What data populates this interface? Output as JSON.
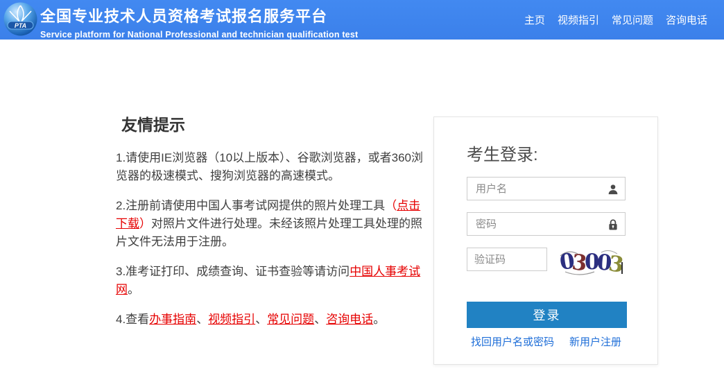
{
  "header": {
    "logo_text": "PTA",
    "title": "全国专业技术人员资格考试报名服务平台",
    "subtitle": "Service platform for National Professional and technician qualification test",
    "nav": [
      {
        "label": "主页"
      },
      {
        "label": "视频指引"
      },
      {
        "label": "常见问题"
      },
      {
        "label": "咨询电话"
      }
    ]
  },
  "tips": {
    "heading": "友情提示",
    "items": [
      {
        "segments": [
          {
            "text": "1.请使用IE浏览器（10以上版本）、谷歌浏览器，或者360浏览器的极速模式、搜狗浏览器的高速模式。"
          }
        ]
      },
      {
        "segments": [
          {
            "text": "2.注册前请使用中国人事考试网提供的照片处理工具"
          },
          {
            "text": "（"
          },
          {
            "text": "点击下载"
          },
          {
            "text": "）"
          },
          {
            "text": "对照片文件进行处理。未经该照片处理工具处理的照片文件无法用于注册。"
          }
        ]
      },
      {
        "segments": [
          {
            "text": "3.准考证打印、成绩查询、证书查验等请访问"
          },
          {
            "text": "中国人事考试网"
          },
          {
            "text": "。"
          }
        ]
      },
      {
        "segments": [
          {
            "text": "4.查看"
          },
          {
            "text": "办事指南"
          },
          {
            "text": "、"
          },
          {
            "text": "视频指引"
          },
          {
            "text": "、"
          },
          {
            "text": "常见问题"
          },
          {
            "text": "、"
          },
          {
            "text": "咨询电话"
          },
          {
            "text": "。"
          }
        ]
      }
    ]
  },
  "login": {
    "heading": "考生登录:",
    "username_placeholder": "用户名",
    "password_placeholder": "密码",
    "captcha_placeholder": "验证码",
    "captcha_value": "03003",
    "captcha_digits": [
      {
        "char": "0",
        "color": "#2c2f80"
      },
      {
        "char": "3",
        "color": "#7c2f2f"
      },
      {
        "char": "0",
        "color": "#2c2f80"
      },
      {
        "char": "0",
        "color": "#2c2f80"
      },
      {
        "char": "3",
        "color": "#8a8c38"
      }
    ],
    "login_button": "登录",
    "forgot_link": "找回用户名或密码",
    "register_link": "新用户注册"
  },
  "colors": {
    "header_bg": "#3e85ee",
    "button_bg": "#2182c3",
    "red_link": "#e60000",
    "blue_link": "#1e6ed8"
  }
}
